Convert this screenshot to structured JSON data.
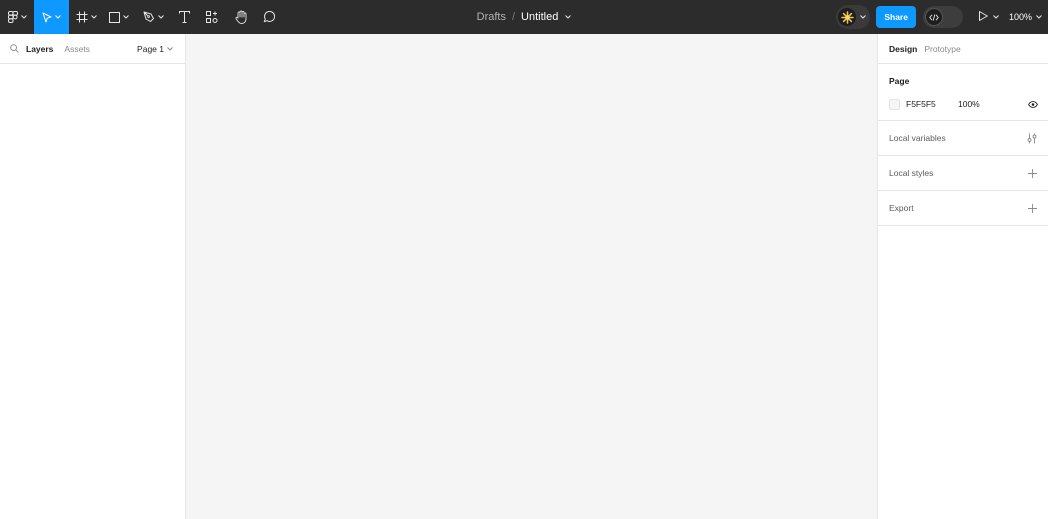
{
  "toolbar": {
    "file": {
      "location": "Drafts",
      "separator": "/",
      "name": "Untitled"
    },
    "share_label": "Share",
    "zoom_label": "100%"
  },
  "left_panel": {
    "tabs": [
      {
        "label": "Layers",
        "active": true
      },
      {
        "label": "Assets",
        "active": false
      }
    ],
    "page_selector": "Page 1"
  },
  "right_panel": {
    "tabs": [
      {
        "label": "Design",
        "active": true
      },
      {
        "label": "Prototype",
        "active": false
      }
    ],
    "page_section": {
      "title": "Page",
      "fill_hex": "F5F5F5",
      "fill_opacity": "100%"
    },
    "sections": [
      {
        "label": "Local variables",
        "icon": "variables-icon"
      },
      {
        "label": "Local styles",
        "icon": "plus-icon"
      },
      {
        "label": "Export",
        "icon": "plus-icon"
      }
    ]
  },
  "colors": {
    "toolbar_bg": "#2c2c2c",
    "accent": "#0d99ff",
    "canvas_bg": "#f5f5f5"
  },
  "icons": [
    "figma-main-menu-icon",
    "move-tool-icon",
    "frame-tool-icon",
    "rectangle-tool-icon",
    "pen-tool-icon",
    "text-tool-icon",
    "resources-icon",
    "hand-tool-icon",
    "comment-icon",
    "avatar-icon",
    "dev-mode-icon",
    "present-icon",
    "search-icon",
    "eye-icon",
    "variables-icon",
    "plus-icon",
    "chevron-down-icon"
  ]
}
